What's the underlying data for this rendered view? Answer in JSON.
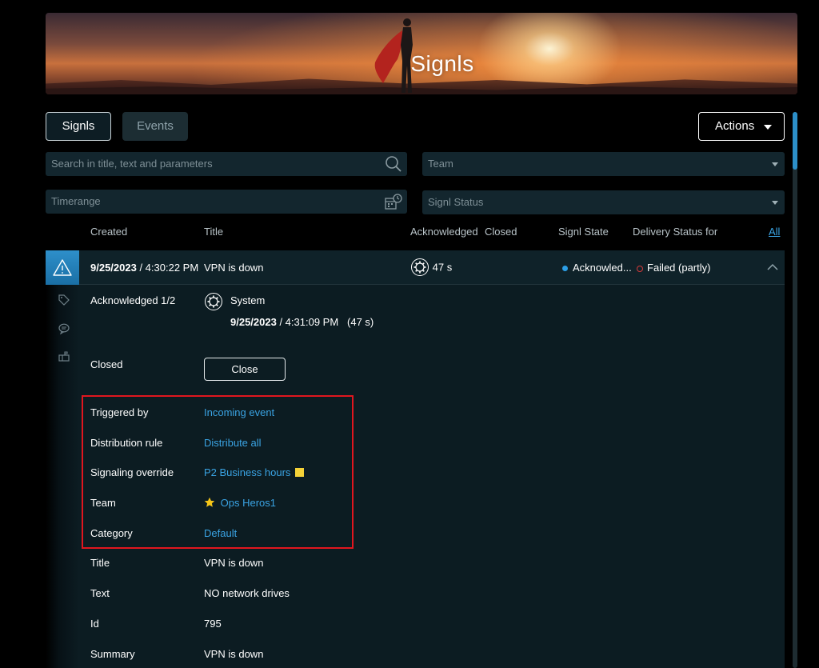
{
  "banner": {
    "title": "Signls"
  },
  "tabs": [
    {
      "label": "Signls",
      "active": true
    },
    {
      "label": "Events",
      "active": false
    }
  ],
  "actions": {
    "label": "Actions"
  },
  "filters": {
    "search_placeholder": "Search in title, text and parameters",
    "timerange_placeholder": "Timerange",
    "team_placeholder": "Team",
    "status_placeholder": "Signl Status"
  },
  "table": {
    "headers": {
      "created": "Created",
      "title": "Title",
      "acknowledged": "Acknowledged",
      "closed": "Closed",
      "state": "Signl State",
      "delivery": "Delivery Status for",
      "all": "All"
    },
    "row": {
      "created_date": "9/25/2023",
      "created_time": " / 4:30:22 PM",
      "title": "VPN is down",
      "ack_time": "47 s",
      "state": "Acknowled...",
      "delivery": "Failed (partly)"
    }
  },
  "detail": {
    "ack_label": "Acknowledged 1/2",
    "ack_by": "System",
    "ack_date": "9/25/2023",
    "ack_time": " / 4:31:09 PM",
    "ack_duration": "(47 s)",
    "closed_label": "Closed",
    "close_button": "Close",
    "triggered_by_label": "Triggered by",
    "triggered_by": "Incoming event",
    "distribution_label": "Distribution rule",
    "distribution": "Distribute all",
    "override_label": "Signaling override",
    "override": "P2 Business hours",
    "team_label": "Team",
    "team": "Ops Heros1",
    "category_label": "Category",
    "category": "Default",
    "title_label": "Title",
    "title": "VPN is down",
    "text_label": "Text",
    "text": "NO network drives",
    "id_label": "Id",
    "id": "795",
    "summary_label": "Summary",
    "summary": "VPN is down"
  },
  "colors": {
    "accent": "#3aa3e3",
    "highlight_border": "#e0161f",
    "acknowledged_dot": "#2c9fe6",
    "failed_ring": "#d23a3a",
    "override_color": "#f5d238"
  }
}
